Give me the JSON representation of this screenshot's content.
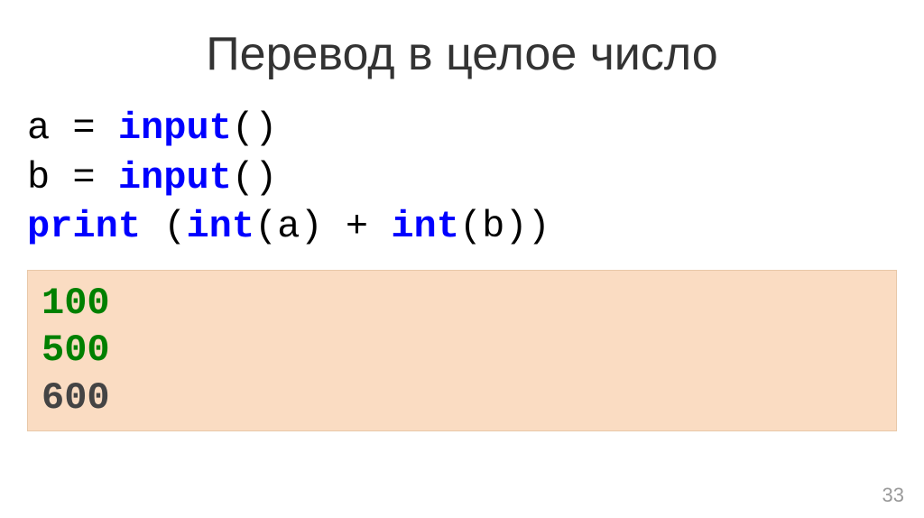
{
  "title": "Перевод в целое число",
  "code": {
    "line1": {
      "a": "a = ",
      "b": "input",
      "c": "()"
    },
    "line2": {
      "a": "b = ",
      "b": "input",
      "c": "()"
    },
    "line3": {
      "a": "print ",
      "b": "(",
      "c": "int",
      "d": "(a) + ",
      "e": "int",
      "f": "(b))"
    }
  },
  "output": {
    "line1": "100",
    "line2": "500",
    "line3": "600"
  },
  "page_number": "33"
}
